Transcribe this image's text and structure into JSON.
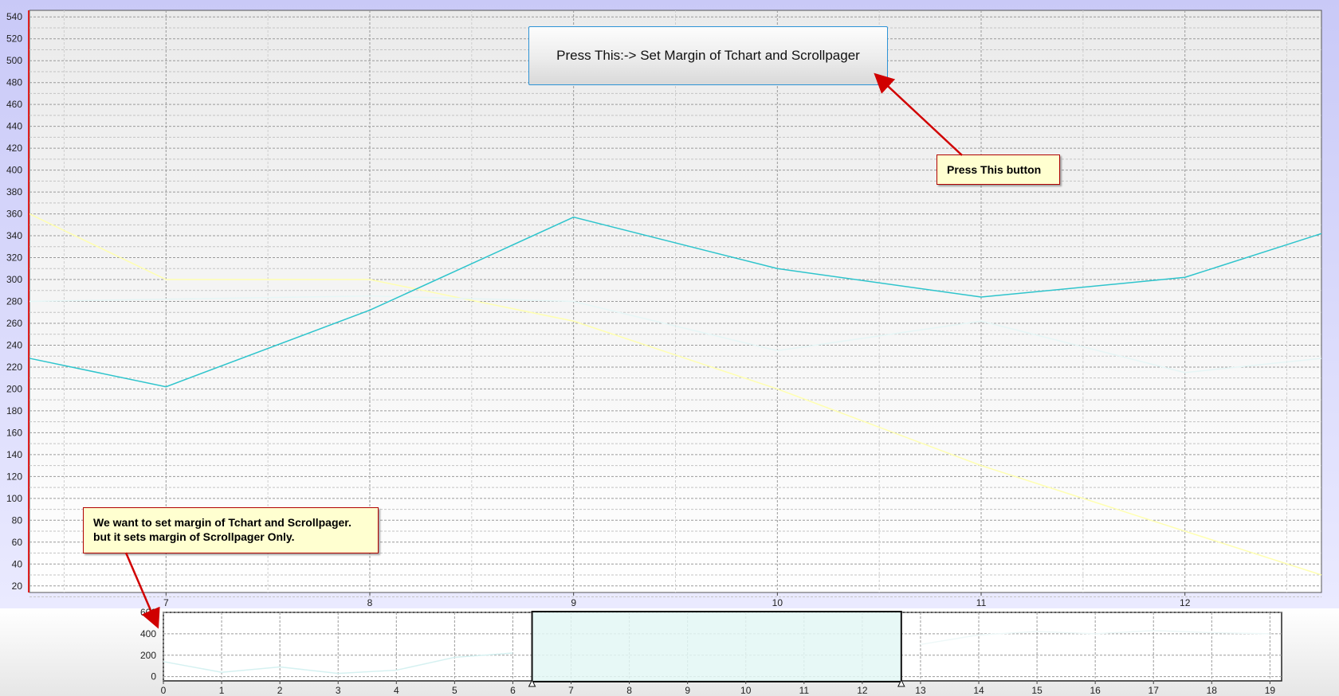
{
  "button": {
    "label": "Press This:-> Set Margin of Tchart and Scrollpager"
  },
  "callouts": {
    "press_button": "Press This button",
    "margin_note_line1": "We want to set margin of Tchart and Scrollpager.",
    "margin_note_line2": "but it sets margin of Scrollpager Only."
  },
  "colors": {
    "series_line": "#2ec4cc",
    "faint_series": "#ffffb0",
    "left_axis": "#e02020",
    "frame_border": "#c0c0f0",
    "pager_selection": "#e3f7f5",
    "callout_border": "#b00000",
    "callout_fill": "#ffffd0",
    "arrow": "#d00000"
  },
  "chart_data": [
    {
      "type": "line",
      "title": "",
      "xlabel": "",
      "ylabel": "",
      "xlim": [
        6.33,
        12.67
      ],
      "ylim": [
        14,
        546
      ],
      "x_ticks": [
        7,
        8,
        9,
        10,
        11,
        12
      ],
      "y_ticks": [
        20,
        40,
        60,
        80,
        100,
        120,
        140,
        160,
        180,
        200,
        220,
        240,
        260,
        280,
        300,
        320,
        340,
        360,
        380,
        400,
        420,
        440,
        460,
        480,
        500,
        520,
        540
      ],
      "grid": true,
      "series": [
        {
          "x": [
            6.33,
            7,
            8,
            9,
            10,
            11,
            12,
            12.67
          ],
          "values": [
            228,
            202,
            272,
            357,
            310,
            284,
            302,
            342
          ]
        }
      ]
    },
    {
      "type": "line",
      "title": "",
      "xlim": [
        0,
        19.2
      ],
      "ylim": [
        -40,
        600
      ],
      "x_ticks": [
        0,
        1,
        2,
        3,
        4,
        5,
        6,
        7,
        8,
        9,
        10,
        11,
        12,
        13,
        14,
        15,
        16,
        17,
        18,
        19
      ],
      "y_ticks": [
        0,
        200,
        400,
        600
      ],
      "grid": true,
      "selection": [
        6.33,
        12.67
      ]
    }
  ]
}
